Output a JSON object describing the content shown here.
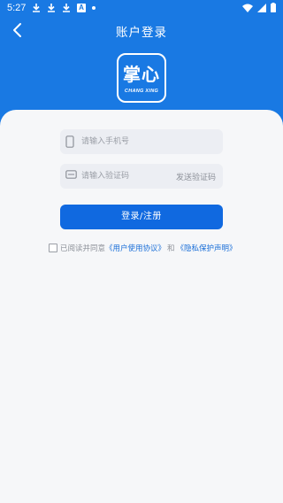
{
  "status_bar": {
    "time": "5:27"
  },
  "header": {
    "title": "账户登录",
    "brand_color": "#1979e3"
  },
  "logo": {
    "main_text": "掌心",
    "sub_text": "CHANG XING"
  },
  "form": {
    "phone_placeholder": "请输入手机号",
    "code_placeholder": "请输入验证码",
    "send_code_label": "发送验证码",
    "submit_label": "登录/注册",
    "button_color": "#1069e0"
  },
  "agreement": {
    "prefix": "已阅读并同意",
    "user_agreement": "《用户使用协议》",
    "conjunction": "和",
    "privacy_policy": "《隐私保护声明》",
    "checked": false
  }
}
